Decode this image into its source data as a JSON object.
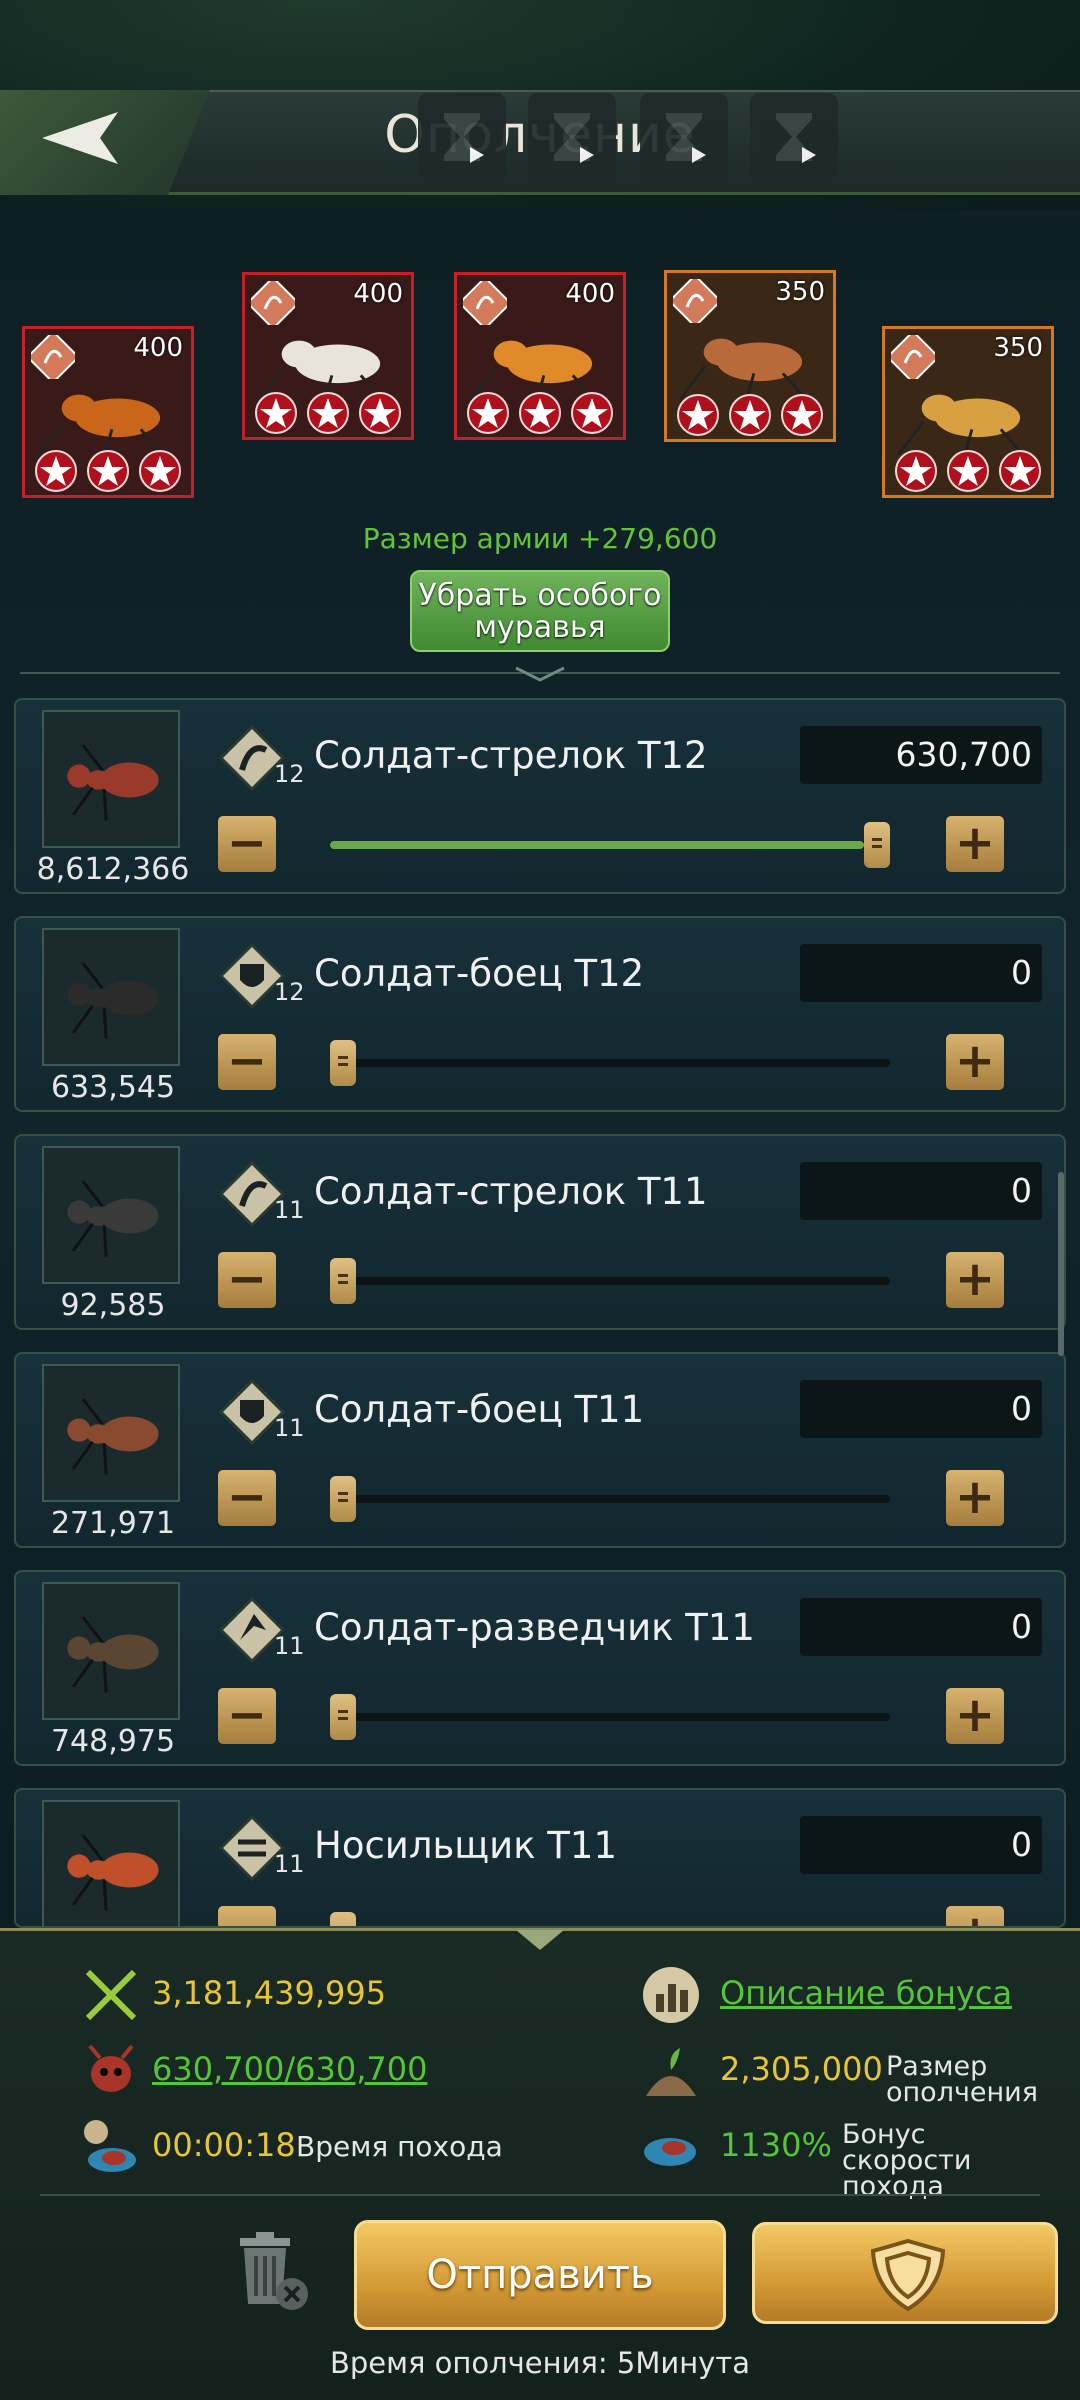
{
  "header": {
    "title": "Ополчение"
  },
  "special_ants": [
    {
      "level": "400",
      "stars": 3
    },
    {
      "level": "400",
      "stars": 3
    },
    {
      "level": "400",
      "stars": 3
    },
    {
      "level": "350",
      "stars": 3
    },
    {
      "level": "350",
      "stars": 3
    }
  ],
  "army_size_text": "Размер армии +279,600",
  "remove_special_label": "Убрать особого муравья",
  "troops": [
    {
      "name": "Солдат-стрелок T12",
      "tier": "12",
      "count": "8,612,366",
      "qty": "630,700",
      "fill": 1.0,
      "icon": "shooter-icon"
    },
    {
      "name": "Солдат-боец T12",
      "tier": "12",
      "count": "633,545",
      "qty": "0",
      "fill": 0.0,
      "icon": "fighter-icon"
    },
    {
      "name": "Солдат-стрелок T11",
      "tier": "11",
      "count": "92,585",
      "qty": "0",
      "fill": 0.0,
      "icon": "shooter-icon"
    },
    {
      "name": "Солдат-боец T11",
      "tier": "11",
      "count": "271,971",
      "qty": "0",
      "fill": 0.0,
      "icon": "fighter-icon"
    },
    {
      "name": "Солдат-разведчик T11",
      "tier": "11",
      "count": "748,975",
      "qty": "0",
      "fill": 0.0,
      "icon": "scout-icon"
    },
    {
      "name": "Носильщик T11",
      "tier": "11",
      "count": "",
      "qty": "0",
      "fill": 0.0,
      "icon": "carrier-icon"
    }
  ],
  "stats": {
    "power": "3,181,439,995",
    "bonus_link": "Описание бонуса",
    "troop_count": "630,700/630,700",
    "militia_size_value": "2,305,000",
    "militia_size_label": "Размер ополчения",
    "march_time_value": "00:00:18",
    "march_time_label": "Время похода",
    "speed_bonus_value": "1130%",
    "speed_bonus_label": "Бонус скорости похода"
  },
  "send_label": "Отправить",
  "footer": "Время ополчения: 5Минута",
  "colors": {
    "accent_green": "#55c437",
    "accent_gold": "#e8c534",
    "special_red": "#c4202a",
    "special_orange": "#d17a22"
  }
}
